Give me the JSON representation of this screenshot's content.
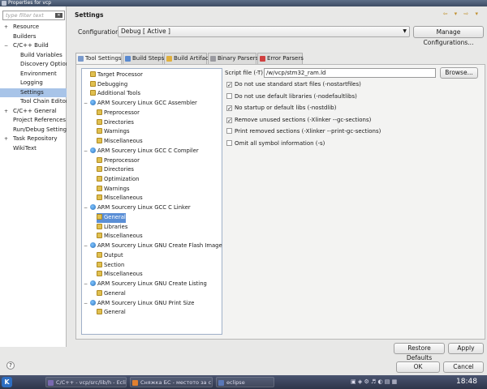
{
  "window": {
    "title": "Properties for vcp"
  },
  "left": {
    "filter_placeholder": "type filter text",
    "items": [
      {
        "label": "Resource",
        "twisty": "+",
        "indent": 0
      },
      {
        "label": "Builders",
        "twisty": "",
        "indent": 0
      },
      {
        "label": "C/C++ Build",
        "twisty": "−",
        "indent": 0
      },
      {
        "label": "Build Variables",
        "twisty": "",
        "indent": 1
      },
      {
        "label": "Discovery Option",
        "twisty": "",
        "indent": 1
      },
      {
        "label": "Environment",
        "twisty": "",
        "indent": 1
      },
      {
        "label": "Logging",
        "twisty": "",
        "indent": 1
      },
      {
        "label": "Settings",
        "twisty": "",
        "indent": 1,
        "selected": true
      },
      {
        "label": "Tool Chain Editor",
        "twisty": "",
        "indent": 1
      },
      {
        "label": "C/C++ General",
        "twisty": "+",
        "indent": 0
      },
      {
        "label": "Project References",
        "twisty": "",
        "indent": 0
      },
      {
        "label": "Run/Debug Settings",
        "twisty": "",
        "indent": 0
      },
      {
        "label": "Task Repository",
        "twisty": "+",
        "indent": 0
      },
      {
        "label": "WikiText",
        "twisty": "",
        "indent": 0
      }
    ]
  },
  "main": {
    "title": "Settings",
    "configuration_label": "Configuration:",
    "configuration_value": "Debug [ Active ]",
    "manage_label": "Manage Configurations...",
    "tabs": [
      {
        "label": "Tool Settings",
        "color": "#7a9acc",
        "active": true
      },
      {
        "label": "Build Steps",
        "color": "#5a8ad0"
      },
      {
        "label": "Build Artifact",
        "color": "#e0b040"
      },
      {
        "label": "Binary Parsers",
        "color": "#9a9aa0"
      },
      {
        "label": "Error Parsers",
        "color": "#d04040"
      }
    ],
    "tree": [
      {
        "label": "Target Processor",
        "level": 0,
        "icon": "sub"
      },
      {
        "label": "Debugging",
        "level": 0,
        "icon": "sub"
      },
      {
        "label": "Additional Tools",
        "level": 0,
        "icon": "sub"
      },
      {
        "label": "ARM Sourcery Linux GCC Assembler",
        "level": 0,
        "icon": "tool",
        "twisty": "−"
      },
      {
        "label": "Preprocessor",
        "level": 1,
        "icon": "sub"
      },
      {
        "label": "Directories",
        "level": 1,
        "icon": "sub"
      },
      {
        "label": "Warnings",
        "level": 1,
        "icon": "sub"
      },
      {
        "label": "Miscellaneous",
        "level": 1,
        "icon": "sub"
      },
      {
        "label": "ARM Sourcery Linux GCC C Compiler",
        "level": 0,
        "icon": "tool",
        "twisty": "−"
      },
      {
        "label": "Preprocessor",
        "level": 1,
        "icon": "sub"
      },
      {
        "label": "Directories",
        "level": 1,
        "icon": "sub"
      },
      {
        "label": "Optimization",
        "level": 1,
        "icon": "sub"
      },
      {
        "label": "Warnings",
        "level": 1,
        "icon": "sub"
      },
      {
        "label": "Miscellaneous",
        "level": 1,
        "icon": "sub"
      },
      {
        "label": "ARM Sourcery Linux GCC C Linker",
        "level": 0,
        "icon": "tool",
        "twisty": "−"
      },
      {
        "label": "General",
        "level": 1,
        "icon": "sub",
        "selected": true
      },
      {
        "label": "Libraries",
        "level": 1,
        "icon": "sub"
      },
      {
        "label": "Miscellaneous",
        "level": 1,
        "icon": "sub"
      },
      {
        "label": "ARM Sourcery Linux GNU Create Flash Image",
        "level": 0,
        "icon": "tool",
        "twisty": "−"
      },
      {
        "label": "Output",
        "level": 1,
        "icon": "sub"
      },
      {
        "label": "Section",
        "level": 1,
        "icon": "sub"
      },
      {
        "label": "Miscellaneous",
        "level": 1,
        "icon": "sub"
      },
      {
        "label": "ARM Sourcery Linux GNU Create Listing",
        "level": 0,
        "icon": "tool",
        "twisty": "−"
      },
      {
        "label": "General",
        "level": 1,
        "icon": "sub"
      },
      {
        "label": "ARM Sourcery Linux GNU Print Size",
        "level": 0,
        "icon": "tool",
        "twisty": "−"
      },
      {
        "label": "General",
        "level": 1,
        "icon": "sub"
      }
    ],
    "script_label": "Script file (-T)",
    "script_value": "/w/vcp/stm32_ram.ld",
    "browse_label": "Browse...",
    "options": [
      {
        "label": "Do not use standard start files (-nostartfiles)",
        "checked": true
      },
      {
        "label": "Do not use default libraries (-nodefaultlibs)",
        "checked": false
      },
      {
        "label": "No startup or default libs (-nostdlib)",
        "checked": true
      },
      {
        "label": "Remove unused sections (-Xlinker --gc-sections)",
        "checked": true
      },
      {
        "label": "Print removed sections (-Xlinker --print-gc-sections)",
        "checked": false
      },
      {
        "label": "Omit all symbol information (-s)",
        "checked": false
      }
    ],
    "restore_label": "Restore Defaults",
    "apply_label": "Apply"
  },
  "footer": {
    "help_label": "?",
    "ok_label": "OK",
    "cancel_label": "Cancel"
  },
  "taskbar": {
    "items": [
      {
        "label": "C/C++ - vcp/src/lib/h - Ecli",
        "color": "#7a6ab0"
      },
      {
        "label": "Сняжка БС - местото за с",
        "color": "#e08030"
      },
      {
        "label": "eclipse",
        "color": "#5a78b8"
      }
    ],
    "clock": "18:48"
  }
}
